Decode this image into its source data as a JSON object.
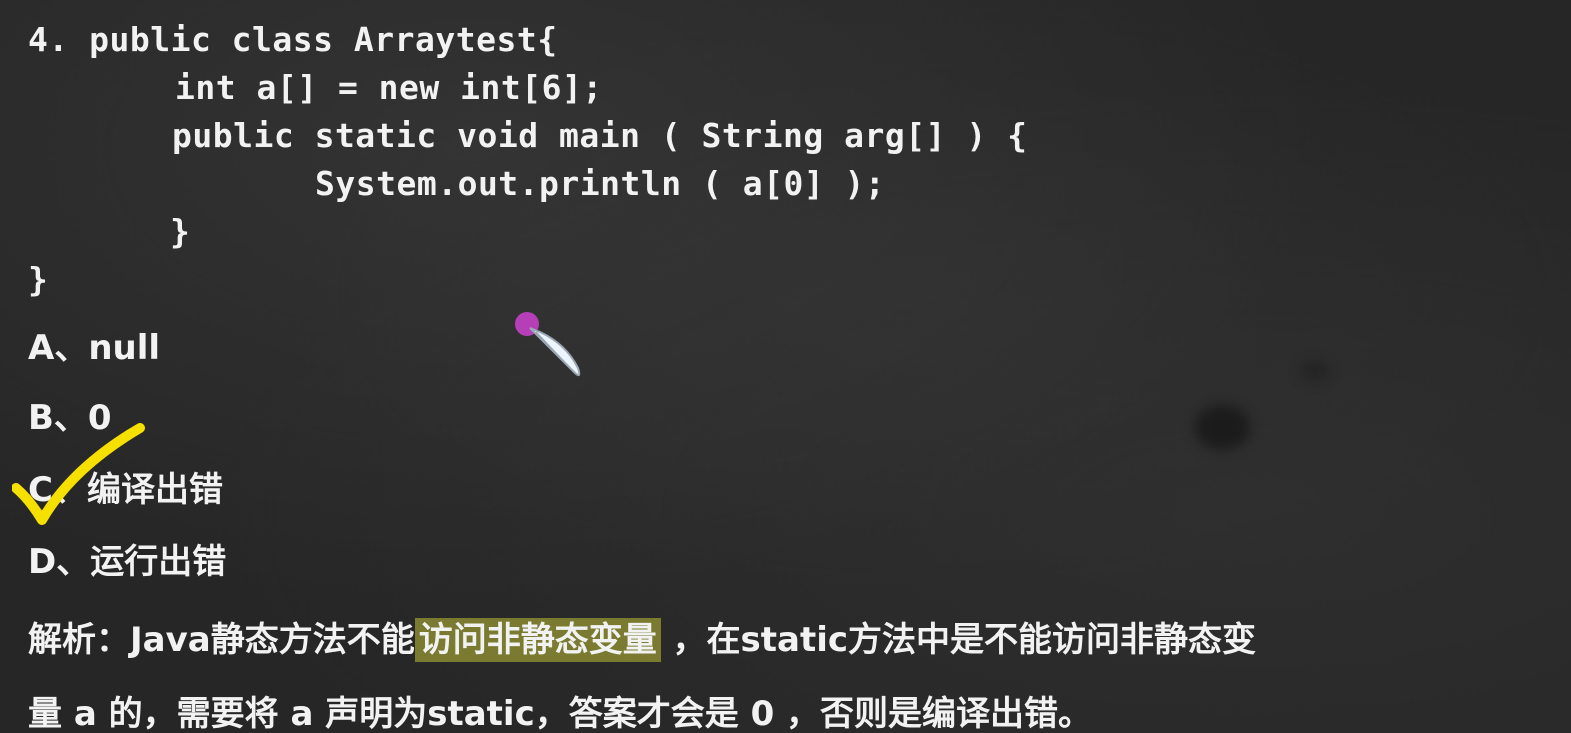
{
  "code": {
    "line1": "4. public class Arraytest{",
    "line2": "int a[] = new int[6];",
    "line3": "public static void main ( String arg[] ) {",
    "line4": "System.out.println ( a[0] );",
    "line5": "}",
    "line6": "}"
  },
  "options": {
    "a": "A、null",
    "b": "B、0",
    "c": "C、编译出错",
    "d": "D、运行出错"
  },
  "explanation": {
    "prefix": "解析：Java静态方法不能",
    "highlight": "访问非静态变量",
    "rest_line1": " ，在static方法中是不能访问非静态变",
    "line2": "量 a 的，需要将 a 声明为static，答案才会是 0 ，否则是编译出错。"
  },
  "icons": {
    "check": "check-mark-icon",
    "pen": "annotation-pen-icon"
  },
  "colors": {
    "board": "#262626",
    "chalk_text": "#f2f2f2",
    "highlight": "#7a7a30",
    "check": "#f5e000",
    "pen_dot": "#b63fb8"
  }
}
